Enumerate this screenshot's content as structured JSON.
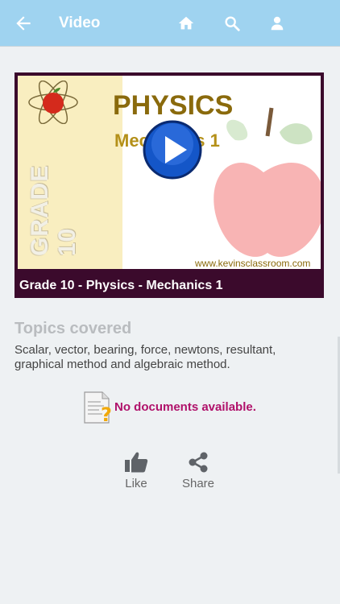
{
  "header": {
    "title": "Video"
  },
  "icons": {
    "back": "arrow-left",
    "home": "home",
    "search": "search",
    "user": "user",
    "play": "play",
    "document": "document-question",
    "like": "thumbs-up",
    "share": "share"
  },
  "video": {
    "thumbnail": {
      "grade_text": "GRADE 10",
      "subject_text": "PHYSICS",
      "topic_text": "Mechanics 1",
      "website": "www.kevinsclassroom.com"
    },
    "caption": "Grade 10 - Physics - Mechanics 1"
  },
  "topics": {
    "heading": "Topics covered",
    "body": "Scalar, vector, bearing, force, newtons, resultant, graphical method and algebraic method."
  },
  "documents": {
    "message": "No documents available."
  },
  "actions": {
    "like_label": "Like",
    "share_label": "Share"
  },
  "colors": {
    "appbar": "#9fd3f0",
    "accent_magenta": "#b0116a",
    "video_frame": "#3b0a2c"
  }
}
